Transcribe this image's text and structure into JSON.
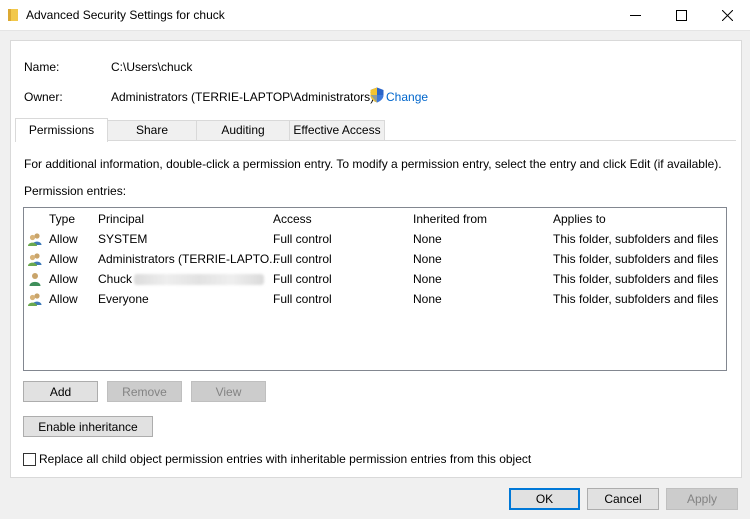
{
  "window": {
    "title": "Advanced Security Settings for chuck",
    "icon": "folder-icon"
  },
  "info": {
    "name_label": "Name:",
    "name_value": "C:\\Users\\chuck",
    "owner_label": "Owner:",
    "owner_value": "Administrators (TERRIE-LAPTOP\\Administrators)",
    "change_link": "Change"
  },
  "tabs": [
    {
      "label": "Permissions",
      "active": true
    },
    {
      "label": "Share",
      "active": false
    },
    {
      "label": "Auditing",
      "active": false
    },
    {
      "label": "Effective Access",
      "active": false
    }
  ],
  "permissions": {
    "info_text": "For additional information, double-click a permission entry. To modify a permission entry, select the entry and click Edit (if available).",
    "entries_label": "Permission entries:",
    "columns": [
      "Type",
      "Principal",
      "Access",
      "Inherited from",
      "Applies to"
    ],
    "rows": [
      {
        "type": "Allow",
        "principal": "SYSTEM",
        "access": "Full control",
        "inherited": "None",
        "applies": "This folder, subfolders and files",
        "icon": "group-icon"
      },
      {
        "type": "Allow",
        "principal": "Administrators (TERRIE-LAPTO...",
        "access": "Full control",
        "inherited": "None",
        "applies": "This folder, subfolders and files",
        "icon": "group-icon"
      },
      {
        "type": "Allow",
        "principal": "Chuck",
        "access": "Full control",
        "inherited": "None",
        "applies": "This folder, subfolders and files",
        "icon": "user-icon"
      },
      {
        "type": "Allow",
        "principal": "Everyone",
        "access": "Full control",
        "inherited": "None",
        "applies": "This folder, subfolders and files",
        "icon": "group-icon"
      }
    ],
    "add_label": "Add",
    "remove_label": "Remove",
    "view_label": "View",
    "enable_inheritance_label": "Enable inheritance",
    "replace_label": "Replace all child object permission entries with inheritable permission entries from this object"
  },
  "footer": {
    "ok_label": "OK",
    "cancel_label": "Cancel",
    "apply_label": "Apply"
  },
  "colors": {
    "link": "#0066cc",
    "default_button_border": "#0078d7"
  }
}
